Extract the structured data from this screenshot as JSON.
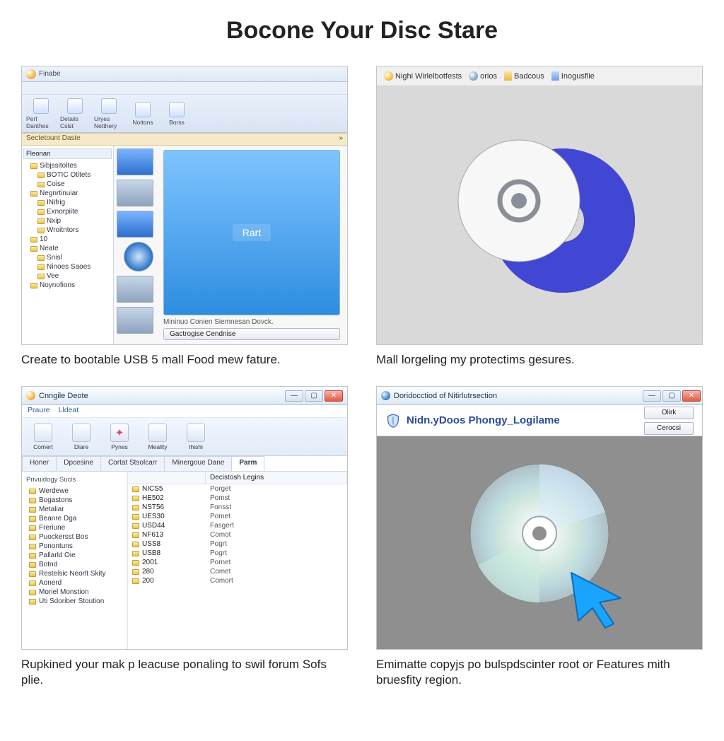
{
  "page_title": "Bocone Your Disc Stare",
  "panel1": {
    "title": "Finabe",
    "menu": [],
    "toolbar": [
      {
        "label": "Perf Danthes"
      },
      {
        "label": "Details Cslst"
      },
      {
        "label": "Uryes Netthery"
      },
      {
        "label": "Nottons"
      },
      {
        "label": "Borss"
      }
    ],
    "location_label": "Sectetount Daste",
    "location_arrow": "»",
    "tree_header": "Fleonan",
    "tree": [
      {
        "label": "Sibjssitoltes",
        "lv": 1
      },
      {
        "label": "BOTIC Otitets",
        "lv": 2
      },
      {
        "label": "Coise",
        "lv": 2
      },
      {
        "label": "Negnrtinuiar",
        "lv": 1
      },
      {
        "label": "INifrig",
        "lv": 2
      },
      {
        "label": "Exnorpiite",
        "lv": 2
      },
      {
        "label": "Nxip",
        "lv": 2
      },
      {
        "label": "Wroitntors",
        "lv": 2
      },
      {
        "label": "10",
        "lv": 1
      },
      {
        "label": "Neate",
        "lv": 1
      },
      {
        "label": "Snisl",
        "lv": 2
      },
      {
        "label": "Ninoes Saoes",
        "lv": 2
      },
      {
        "label": "Vee",
        "lv": 2
      },
      {
        "label": "Noynofions",
        "lv": 1
      }
    ],
    "preview_button": "Rart",
    "under_text": "Mininuo Conien Siemnesan Dovck.",
    "under_button": "Gactrogise Cendnise",
    "caption": "Create to bootable USB 5 mall Food mew fature."
  },
  "panel2": {
    "toolbar": [
      {
        "label": "Nighi Wirlelbotfests",
        "ico": "a"
      },
      {
        "label": "orios",
        "ico": "b"
      },
      {
        "label": "Badcous",
        "ico": "c"
      },
      {
        "label": "Inogusflie",
        "ico": "d"
      }
    ],
    "caption": "Mall lorgeling my protectims gesures."
  },
  "panel3": {
    "title": "Cnngile Deote",
    "menu": [
      "Praure",
      "Lldeat"
    ],
    "toolbar": [
      {
        "label": "Comert"
      },
      {
        "label": "Diare"
      },
      {
        "label": "Pynes",
        "star": true
      },
      {
        "label": "Meallty"
      },
      {
        "label": "Ihishi"
      }
    ],
    "tabs": [
      "Honer",
      "Dpcesine",
      "Cortat Stsolcarr",
      "Minergoue Dane",
      "Parm"
    ],
    "active_tab": 4,
    "tree_header": "Privuidogy Sucis",
    "tree": [
      {
        "label": "Werdewe"
      },
      {
        "label": "Bogastons"
      },
      {
        "label": "Metaliar"
      },
      {
        "label": "Beanre Dga"
      },
      {
        "label": "Freriune"
      },
      {
        "label": "Puockersst Bos"
      },
      {
        "label": "Ponontuns"
      },
      {
        "label": "Pallarld Oie"
      },
      {
        "label": "Botnd"
      },
      {
        "label": "Restelsic Neorlt Skity"
      },
      {
        "label": "Aonerd"
      },
      {
        "label": "Moriel Monstion"
      },
      {
        "label": "Uti Sdoriber Stoution"
      }
    ],
    "list_header_a": "",
    "list_header_b": "Decistosh Legins",
    "rows": [
      {
        "a": "NICS5",
        "b": "Porget"
      },
      {
        "a": "HE502",
        "b": "Pomst"
      },
      {
        "a": "NST56",
        "b": "Fonsst"
      },
      {
        "a": "UES30",
        "b": "Pomet"
      },
      {
        "a": "USD44",
        "b": "Fasgert"
      },
      {
        "a": "NF613",
        "b": "Comot"
      },
      {
        "a": "USS8",
        "b": "Pogrt"
      },
      {
        "a": "USB8",
        "b": "Pogrt"
      },
      {
        "a": "2001",
        "b": "Pornet"
      },
      {
        "a": "280",
        "b": "Comet"
      },
      {
        "a": "200",
        "b": "Comort"
      }
    ],
    "caption": "Rupkined your mak p leacuse ponaling to swil forum Sofs plie."
  },
  "panel4": {
    "title": "Doridocctiod of Nitirlutrsection",
    "brand": "Nidn.yDoos Phongy_Logilame",
    "ok_label": "Olirk",
    "cancel_label": "Cerocsi",
    "caption": "Emimatte copyjs po bulspdscinter root or Features mith bruesfity region."
  }
}
